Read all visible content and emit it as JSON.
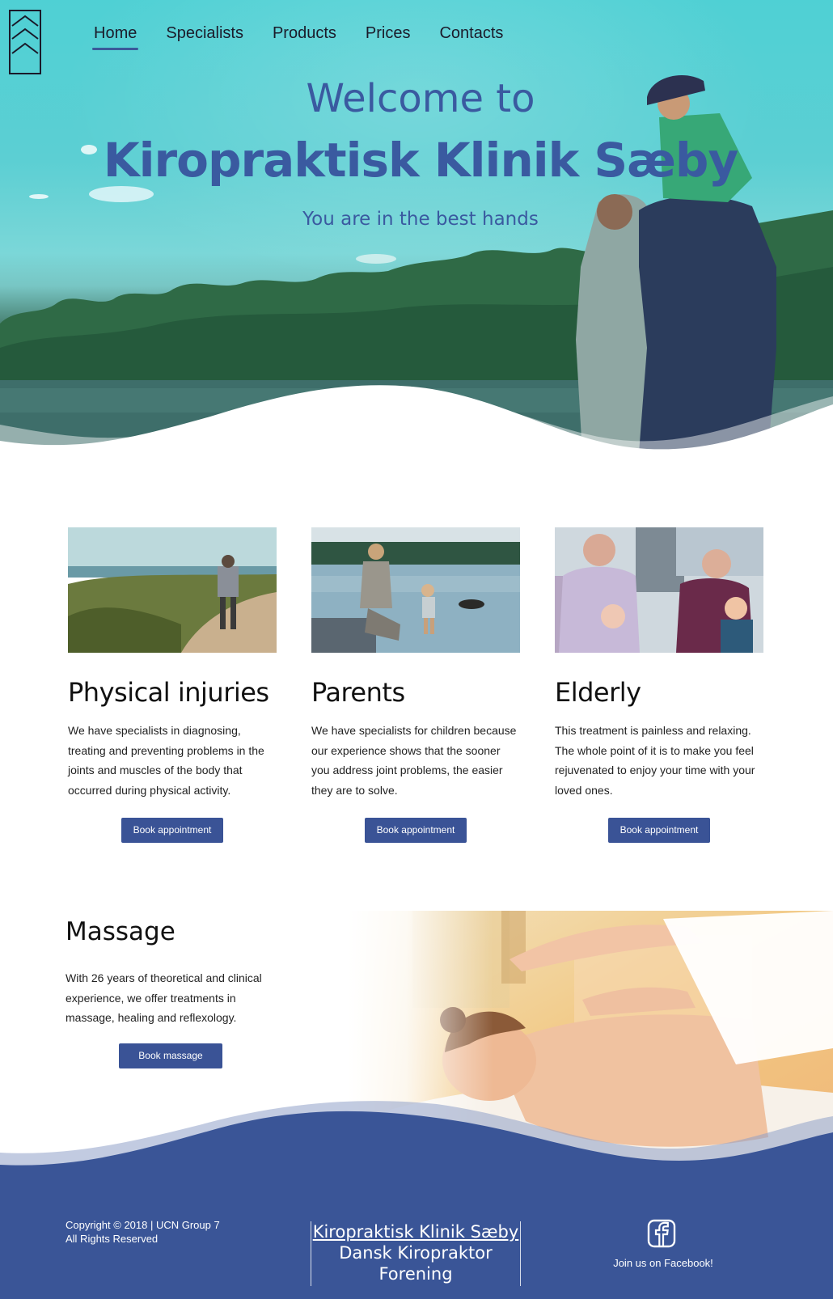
{
  "nav": {
    "items": [
      {
        "label": "Home",
        "active": true
      },
      {
        "label": "Specialists"
      },
      {
        "label": "Products"
      },
      {
        "label": "Prices"
      },
      {
        "label": "Contacts"
      }
    ]
  },
  "hero": {
    "title_line1": "Welcome to",
    "title_line2": "Kiropraktisk Klinik Sæby",
    "subtitle": "You are in the best hands"
  },
  "cards": [
    {
      "title": "Physical injuries",
      "text": "We have specialists in diagnosing, treating and preventing problems in the joints and muscles of the body that occurred during physical activity.",
      "button": "Book appointment"
    },
    {
      "title": "Parents",
      "text": "We have specialists for children because our experience shows that the sooner you address joint problems, the easier they are to solve.",
      "button": "Book appointment"
    },
    {
      "title": "Elderly",
      "text": "This treatment is painless and relaxing. The whole point of it is to make you feel rejuvenated to enjoy your time with your loved ones.",
      "button": "Book appointment"
    }
  ],
  "massage": {
    "title": "Massage",
    "text": "With 26 years of theoretical and clinical experience, we offer treatments in massage, healing and reflexology.",
    "button": "Book massage"
  },
  "footer": {
    "copyright_line1": "Copyright © 2018 | UCN Group 7",
    "copyright_line2": "All Rights Reserved",
    "clinic_link": "Kiropraktisk Klinik Sæby",
    "association_line1": "Dansk Kiropraktor",
    "association_line2": "Forening",
    "facebook_text": "Join us on Facebook!"
  },
  "colors": {
    "brand_blue": "#3a5397",
    "footer_blue": "#3a5597",
    "title_blue": "#3a5aa0"
  }
}
